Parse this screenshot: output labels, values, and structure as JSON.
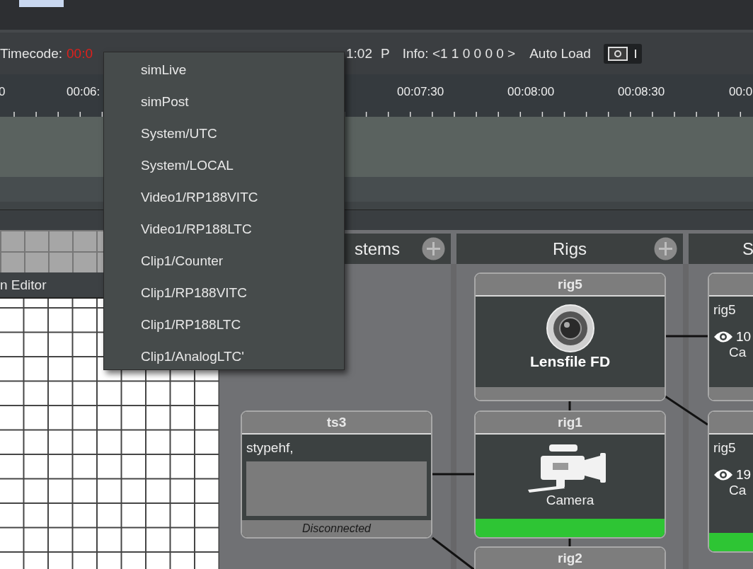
{
  "toolbar": {
    "timecode_label": "Timecode:",
    "timecode_value": "00:0",
    "live_timecode_tail": "1:02",
    "mode": "P",
    "info": "Info: <1 1 0 0 0 0 >",
    "auto_load": {
      "label": "Auto Load",
      "on": false
    }
  },
  "ruler": {
    "labels": [
      "0",
      "00:06:",
      "00:07:30",
      "00:08:00",
      "00:08:30",
      "00:0"
    ]
  },
  "panel": {
    "title": "n Editor"
  },
  "columns": [
    {
      "title": "stems",
      "addable": true
    },
    {
      "title": "Rigs",
      "addable": true
    },
    {
      "title": "S",
      "addable": false
    }
  ],
  "nodes": [
    {
      "kind": "rig",
      "title": "rig5",
      "caption": "Lensfile FD",
      "connected": false
    },
    {
      "kind": "rig",
      "title": "rig1",
      "caption": "Camera",
      "connected": true
    },
    {
      "kind": "rig",
      "title": "rig2"
    },
    {
      "kind": "tracking",
      "title": "ts3",
      "text": "stypehf,",
      "status_text": "Disconnected",
      "connected": false
    },
    {
      "kind": "viewer",
      "text": "rig5",
      "value": "10",
      "caption": "Ca",
      "connected": false
    },
    {
      "kind": "viewer",
      "text": "rig5",
      "value": "19",
      "caption": "Ca",
      "connected": true
    }
  ],
  "menu": {
    "items": [
      "simLive",
      "simPost",
      "System/UTC",
      "System/LOCAL",
      "Video1/RP188VITC",
      "Video1/RP188LTC",
      "Clip1/Counter",
      "Clip1/RP188VITC",
      "Clip1/RP188LTC",
      "Clip1/AnalogLTC'"
    ]
  }
}
